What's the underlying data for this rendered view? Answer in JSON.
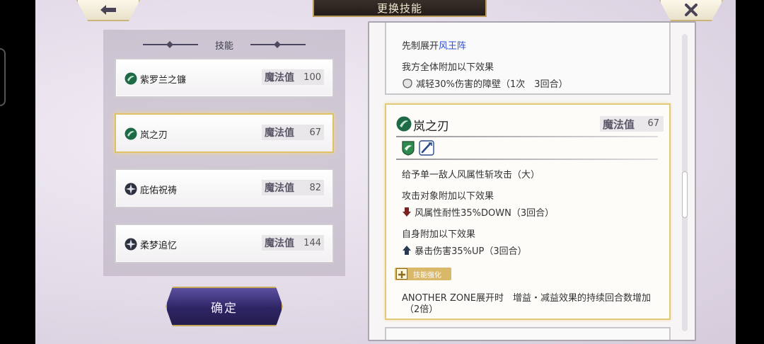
{
  "header": {
    "title": "更换技能",
    "back_icon": "arrow-left-icon",
    "close_icon": "x-icon"
  },
  "skill_panel": {
    "title": "技能",
    "skills": [
      {
        "name": "紫罗兰之镰",
        "mp_label": "魔法值",
        "mp": "100",
        "icon": "wind-orb-icon",
        "selected": false
      },
      {
        "name": "岚之刃",
        "mp_label": "魔法值",
        "mp": "67",
        "icon": "wind-orb-icon",
        "selected": true
      },
      {
        "name": "庇佑祝祷",
        "mp_label": "魔法值",
        "mp": "82",
        "icon": "star-seal-icon",
        "selected": false
      },
      {
        "name": "柔梦追忆",
        "mp_label": "魔法值",
        "mp": "144",
        "icon": "star-seal-icon",
        "selected": false
      }
    ],
    "confirm_label": "确定"
  },
  "detail": {
    "prev_card": {
      "line1_prefix": "先制展开",
      "line1_link": "风王阵",
      "line2": "我方全体附加以下效果",
      "line3": "减轻30%伤害的障壁（1次　3回合）"
    },
    "main_card": {
      "title": "岚之刃",
      "mp_label": "魔法值",
      "mp": "67",
      "desc1": "给予单一敌人风属性斩攻击（大）",
      "desc2": "攻击对象附加以下效果",
      "desc3": "风属性耐性35%DOWN（3回合）",
      "desc4": "自身附加以下效果",
      "desc5": "暴击伤害35%UP（3回合）",
      "enhance_tag": "技能强化",
      "desc6": "ANOTHER ZONE展开时　增益・减益效果的持续回合数增加",
      "desc7": "（2倍）"
    }
  },
  "colors": {
    "gold": "#e1c066",
    "confirm_bg": "#2e2564",
    "link": "#2e4fd6",
    "down_arrow": "#7a2320",
    "up_arrow": "#2a3a55"
  }
}
